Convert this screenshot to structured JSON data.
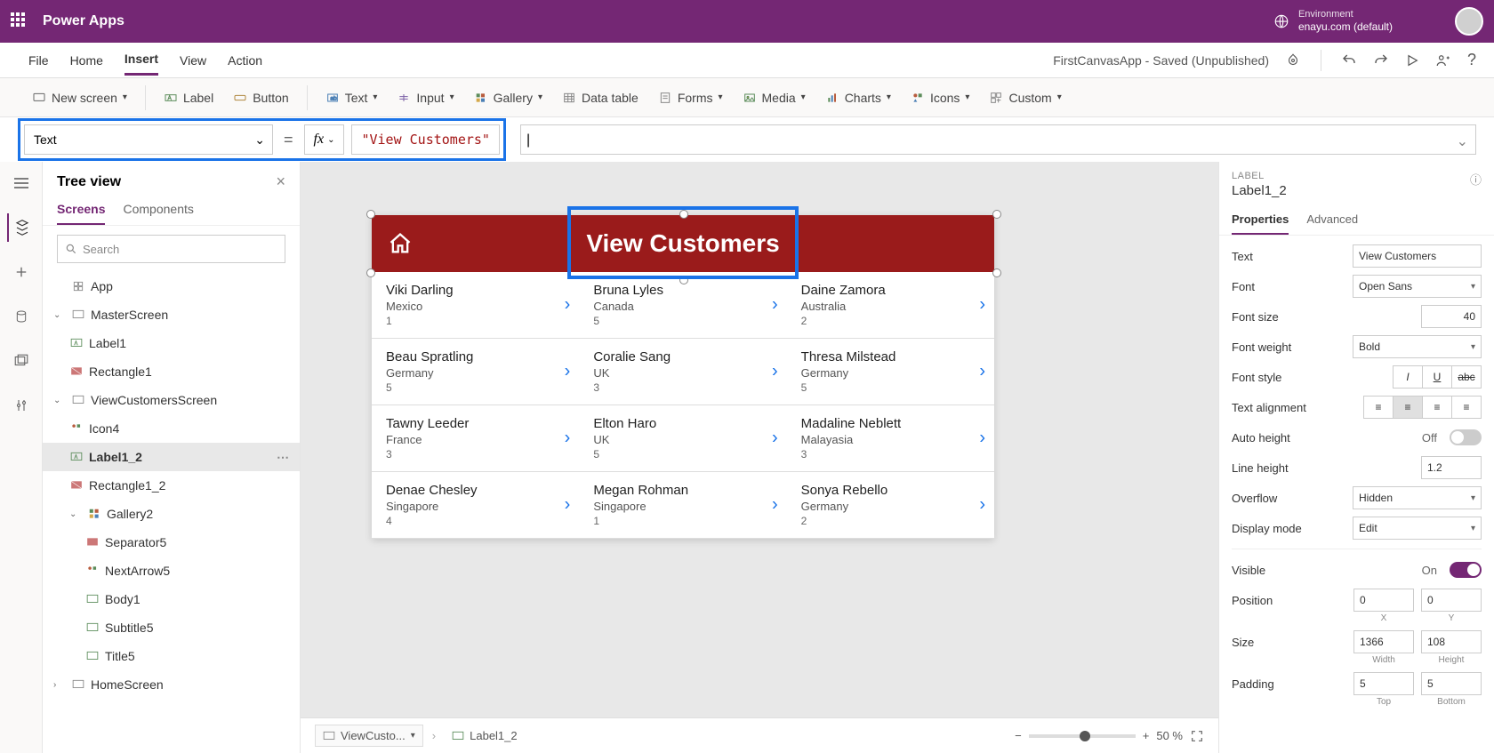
{
  "topbar": {
    "product": "Power Apps",
    "env_label": "Environment",
    "env_name": "enayu.com (default)"
  },
  "menubar": {
    "items": [
      "File",
      "Home",
      "Insert",
      "View",
      "Action"
    ],
    "active": "Insert",
    "doc": "FirstCanvasApp - Saved (Unpublished)"
  },
  "ribbon": {
    "new_screen": "New screen",
    "label": "Label",
    "button": "Button",
    "text": "Text",
    "input": "Input",
    "gallery": "Gallery",
    "data_table": "Data table",
    "forms": "Forms",
    "media": "Media",
    "charts": "Charts",
    "icons": "Icons",
    "custom": "Custom"
  },
  "formula": {
    "property": "Text",
    "value": "\"View Customers\""
  },
  "tree": {
    "title": "Tree view",
    "tabs": {
      "screens": "Screens",
      "components": "Components"
    },
    "search_placeholder": "Search",
    "app": "App",
    "nodes": {
      "master": "MasterScreen",
      "label1": "Label1",
      "rect1": "Rectangle1",
      "view_screen": "ViewCustomersScreen",
      "icon4": "Icon4",
      "label1_2": "Label1_2",
      "rect1_2": "Rectangle1_2",
      "gallery2": "Gallery2",
      "sep5": "Separator5",
      "next5": "NextArrow5",
      "body1": "Body1",
      "subtitle5": "Subtitle5",
      "title5": "Title5",
      "home": "HomeScreen"
    }
  },
  "canvas": {
    "header_title": "View Customers",
    "customers": [
      [
        {
          "name": "Viki  Darling",
          "country": "Mexico",
          "id": "1"
        },
        {
          "name": "Bruna  Lyles",
          "country": "Canada",
          "id": "5"
        },
        {
          "name": "Daine  Zamora",
          "country": "Australia",
          "id": "2"
        }
      ],
      [
        {
          "name": "Beau  Spratling",
          "country": "Germany",
          "id": "5"
        },
        {
          "name": "Coralie  Sang",
          "country": "UK",
          "id": "3"
        },
        {
          "name": "Thresa  Milstead",
          "country": "Germany",
          "id": "5"
        }
      ],
      [
        {
          "name": "Tawny  Leeder",
          "country": "France",
          "id": "3"
        },
        {
          "name": "Elton  Haro",
          "country": "UK",
          "id": "5"
        },
        {
          "name": "Madaline  Neblett",
          "country": "Malayasia",
          "id": "3"
        }
      ],
      [
        {
          "name": "Denae  Chesley",
          "country": "Singapore",
          "id": "4"
        },
        {
          "name": "Megan  Rohman",
          "country": "Singapore",
          "id": "1"
        },
        {
          "name": "Sonya  Rebello",
          "country": "Germany",
          "id": "2"
        }
      ]
    ]
  },
  "footer": {
    "bc_screen": "ViewCusto...",
    "bc_label": "Label1_2",
    "zoom": "50  %",
    "plus": "+",
    "minus": "−"
  },
  "props": {
    "kind": "LABEL",
    "name": "Label1_2",
    "tabs": {
      "properties": "Properties",
      "advanced": "Advanced"
    },
    "rows": {
      "text_l": "Text",
      "text_v": "View Customers",
      "font_l": "Font",
      "font_v": "Open Sans",
      "fontsize_l": "Font size",
      "fontsize_v": "40",
      "fontweight_l": "Font weight",
      "fontweight_v": "Bold",
      "fontstyle_l": "Font style",
      "align_l": "Text alignment",
      "autoheight_l": "Auto height",
      "autoheight_v": "Off",
      "lineheight_l": "Line height",
      "lineheight_v": "1.2",
      "overflow_l": "Overflow",
      "overflow_v": "Hidden",
      "display_l": "Display mode",
      "display_v": "Edit",
      "visible_l": "Visible",
      "visible_v": "On",
      "position_l": "Position",
      "pos_x": "0",
      "pos_y": "0",
      "pos_xl": "X",
      "pos_yl": "Y",
      "size_l": "Size",
      "size_w": "1366",
      "size_h": "108",
      "size_wl": "Width",
      "size_hl": "Height",
      "padding_l": "Padding",
      "pad_t": "5",
      "pad_b": "5",
      "pad_tl": "Top",
      "pad_bl": "Bottom"
    }
  }
}
